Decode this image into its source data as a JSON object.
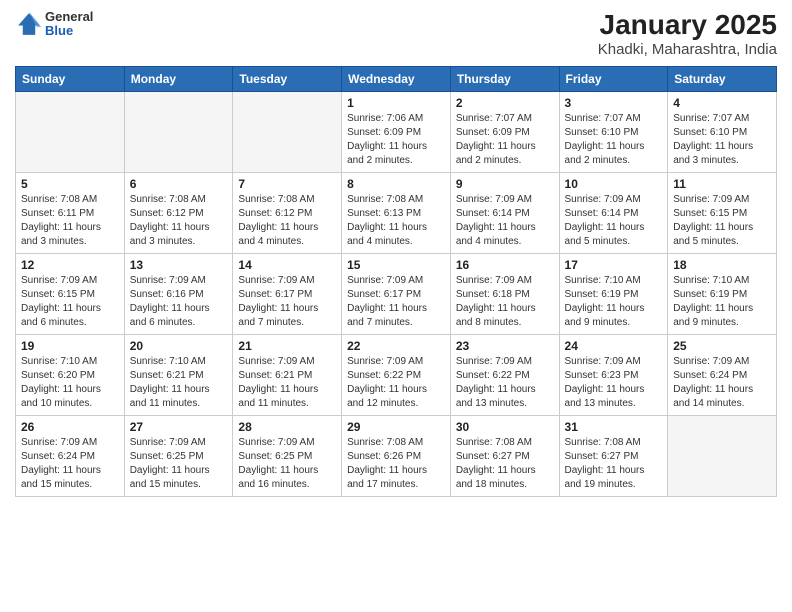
{
  "header": {
    "logo": {
      "general": "General",
      "blue": "Blue"
    },
    "title": "January 2025",
    "subtitle": "Khadki, Maharashtra, India"
  },
  "weekdays": [
    "Sunday",
    "Monday",
    "Tuesday",
    "Wednesday",
    "Thursday",
    "Friday",
    "Saturday"
  ],
  "weeks": [
    [
      {
        "day": "",
        "sunrise": "",
        "sunset": "",
        "daylight": "",
        "empty": true
      },
      {
        "day": "",
        "sunrise": "",
        "sunset": "",
        "daylight": "",
        "empty": true
      },
      {
        "day": "",
        "sunrise": "",
        "sunset": "",
        "daylight": "",
        "empty": true
      },
      {
        "day": "1",
        "sunrise": "Sunrise: 7:06 AM",
        "sunset": "Sunset: 6:09 PM",
        "daylight": "Daylight: 11 hours and 2 minutes.",
        "empty": false
      },
      {
        "day": "2",
        "sunrise": "Sunrise: 7:07 AM",
        "sunset": "Sunset: 6:09 PM",
        "daylight": "Daylight: 11 hours and 2 minutes.",
        "empty": false
      },
      {
        "day": "3",
        "sunrise": "Sunrise: 7:07 AM",
        "sunset": "Sunset: 6:10 PM",
        "daylight": "Daylight: 11 hours and 2 minutes.",
        "empty": false
      },
      {
        "day": "4",
        "sunrise": "Sunrise: 7:07 AM",
        "sunset": "Sunset: 6:10 PM",
        "daylight": "Daylight: 11 hours and 3 minutes.",
        "empty": false
      }
    ],
    [
      {
        "day": "5",
        "sunrise": "Sunrise: 7:08 AM",
        "sunset": "Sunset: 6:11 PM",
        "daylight": "Daylight: 11 hours and 3 minutes.",
        "empty": false
      },
      {
        "day": "6",
        "sunrise": "Sunrise: 7:08 AM",
        "sunset": "Sunset: 6:12 PM",
        "daylight": "Daylight: 11 hours and 3 minutes.",
        "empty": false
      },
      {
        "day": "7",
        "sunrise": "Sunrise: 7:08 AM",
        "sunset": "Sunset: 6:12 PM",
        "daylight": "Daylight: 11 hours and 4 minutes.",
        "empty": false
      },
      {
        "day": "8",
        "sunrise": "Sunrise: 7:08 AM",
        "sunset": "Sunset: 6:13 PM",
        "daylight": "Daylight: 11 hours and 4 minutes.",
        "empty": false
      },
      {
        "day": "9",
        "sunrise": "Sunrise: 7:09 AM",
        "sunset": "Sunset: 6:14 PM",
        "daylight": "Daylight: 11 hours and 4 minutes.",
        "empty": false
      },
      {
        "day": "10",
        "sunrise": "Sunrise: 7:09 AM",
        "sunset": "Sunset: 6:14 PM",
        "daylight": "Daylight: 11 hours and 5 minutes.",
        "empty": false
      },
      {
        "day": "11",
        "sunrise": "Sunrise: 7:09 AM",
        "sunset": "Sunset: 6:15 PM",
        "daylight": "Daylight: 11 hours and 5 minutes.",
        "empty": false
      }
    ],
    [
      {
        "day": "12",
        "sunrise": "Sunrise: 7:09 AM",
        "sunset": "Sunset: 6:15 PM",
        "daylight": "Daylight: 11 hours and 6 minutes.",
        "empty": false
      },
      {
        "day": "13",
        "sunrise": "Sunrise: 7:09 AM",
        "sunset": "Sunset: 6:16 PM",
        "daylight": "Daylight: 11 hours and 6 minutes.",
        "empty": false
      },
      {
        "day": "14",
        "sunrise": "Sunrise: 7:09 AM",
        "sunset": "Sunset: 6:17 PM",
        "daylight": "Daylight: 11 hours and 7 minutes.",
        "empty": false
      },
      {
        "day": "15",
        "sunrise": "Sunrise: 7:09 AM",
        "sunset": "Sunset: 6:17 PM",
        "daylight": "Daylight: 11 hours and 7 minutes.",
        "empty": false
      },
      {
        "day": "16",
        "sunrise": "Sunrise: 7:09 AM",
        "sunset": "Sunset: 6:18 PM",
        "daylight": "Daylight: 11 hours and 8 minutes.",
        "empty": false
      },
      {
        "day": "17",
        "sunrise": "Sunrise: 7:10 AM",
        "sunset": "Sunset: 6:19 PM",
        "daylight": "Daylight: 11 hours and 9 minutes.",
        "empty": false
      },
      {
        "day": "18",
        "sunrise": "Sunrise: 7:10 AM",
        "sunset": "Sunset: 6:19 PM",
        "daylight": "Daylight: 11 hours and 9 minutes.",
        "empty": false
      }
    ],
    [
      {
        "day": "19",
        "sunrise": "Sunrise: 7:10 AM",
        "sunset": "Sunset: 6:20 PM",
        "daylight": "Daylight: 11 hours and 10 minutes.",
        "empty": false
      },
      {
        "day": "20",
        "sunrise": "Sunrise: 7:10 AM",
        "sunset": "Sunset: 6:21 PM",
        "daylight": "Daylight: 11 hours and 11 minutes.",
        "empty": false
      },
      {
        "day": "21",
        "sunrise": "Sunrise: 7:09 AM",
        "sunset": "Sunset: 6:21 PM",
        "daylight": "Daylight: 11 hours and 11 minutes.",
        "empty": false
      },
      {
        "day": "22",
        "sunrise": "Sunrise: 7:09 AM",
        "sunset": "Sunset: 6:22 PM",
        "daylight": "Daylight: 11 hours and 12 minutes.",
        "empty": false
      },
      {
        "day": "23",
        "sunrise": "Sunrise: 7:09 AM",
        "sunset": "Sunset: 6:22 PM",
        "daylight": "Daylight: 11 hours and 13 minutes.",
        "empty": false
      },
      {
        "day": "24",
        "sunrise": "Sunrise: 7:09 AM",
        "sunset": "Sunset: 6:23 PM",
        "daylight": "Daylight: 11 hours and 13 minutes.",
        "empty": false
      },
      {
        "day": "25",
        "sunrise": "Sunrise: 7:09 AM",
        "sunset": "Sunset: 6:24 PM",
        "daylight": "Daylight: 11 hours and 14 minutes.",
        "empty": false
      }
    ],
    [
      {
        "day": "26",
        "sunrise": "Sunrise: 7:09 AM",
        "sunset": "Sunset: 6:24 PM",
        "daylight": "Daylight: 11 hours and 15 minutes.",
        "empty": false
      },
      {
        "day": "27",
        "sunrise": "Sunrise: 7:09 AM",
        "sunset": "Sunset: 6:25 PM",
        "daylight": "Daylight: 11 hours and 15 minutes.",
        "empty": false
      },
      {
        "day": "28",
        "sunrise": "Sunrise: 7:09 AM",
        "sunset": "Sunset: 6:25 PM",
        "daylight": "Daylight: 11 hours and 16 minutes.",
        "empty": false
      },
      {
        "day": "29",
        "sunrise": "Sunrise: 7:08 AM",
        "sunset": "Sunset: 6:26 PM",
        "daylight": "Daylight: 11 hours and 17 minutes.",
        "empty": false
      },
      {
        "day": "30",
        "sunrise": "Sunrise: 7:08 AM",
        "sunset": "Sunset: 6:27 PM",
        "daylight": "Daylight: 11 hours and 18 minutes.",
        "empty": false
      },
      {
        "day": "31",
        "sunrise": "Sunrise: 7:08 AM",
        "sunset": "Sunset: 6:27 PM",
        "daylight": "Daylight: 11 hours and 19 minutes.",
        "empty": false
      },
      {
        "day": "",
        "sunrise": "",
        "sunset": "",
        "daylight": "",
        "empty": true
      }
    ]
  ]
}
